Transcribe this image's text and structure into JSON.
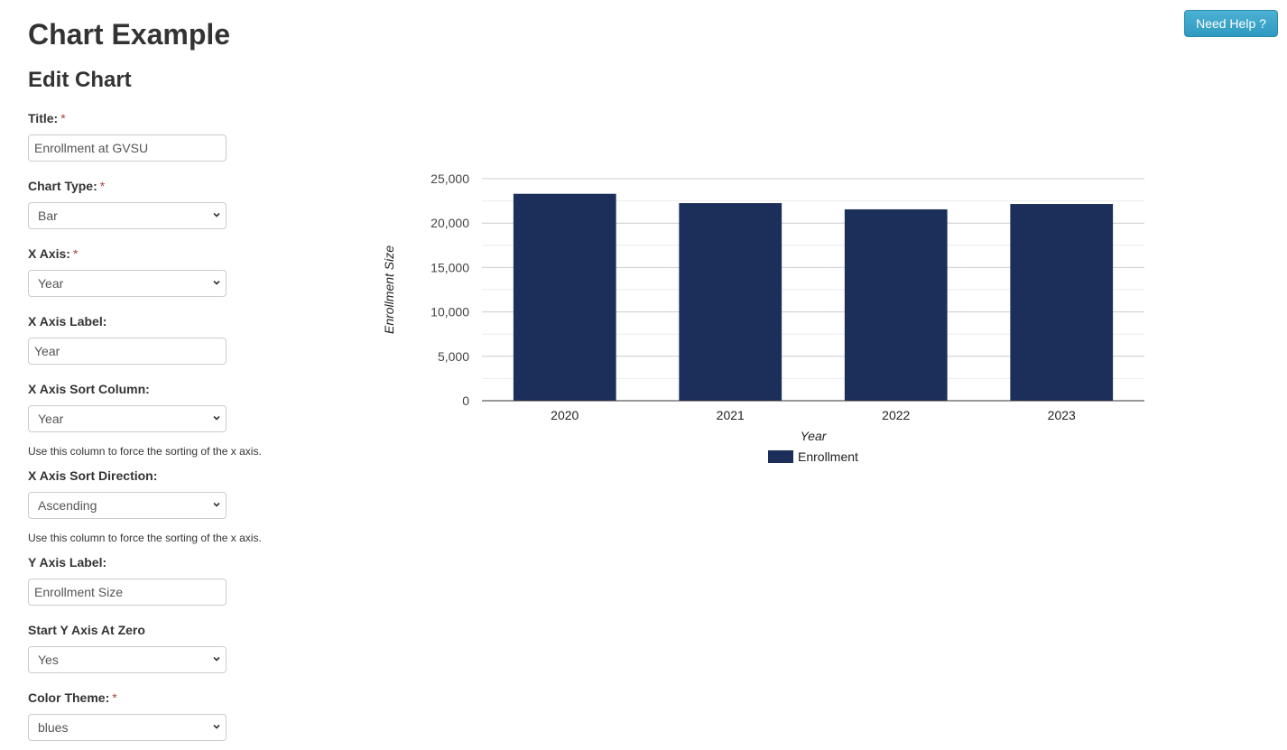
{
  "header": {
    "title": "Chart Example",
    "subtitle": "Edit Chart",
    "help_button": "Need Help ?"
  },
  "form": {
    "title": {
      "label": "Title:",
      "required": "*",
      "value": "Enrollment at GVSU"
    },
    "chart_type": {
      "label": "Chart Type:",
      "required": "*",
      "value": "Bar"
    },
    "x_axis": {
      "label": "X Axis:",
      "required": "*",
      "value": "Year"
    },
    "x_axis_label": {
      "label": "X Axis Label:",
      "value": "Year"
    },
    "x_sort_column": {
      "label": "X Axis Sort Column:",
      "value": "Year",
      "help": "Use this column to force the sorting of the x axis."
    },
    "x_sort_direction": {
      "label": "X Axis Sort Direction:",
      "value": "Ascending",
      "help": "Use this column to force the sorting of the x axis."
    },
    "y_axis_label": {
      "label": "Y Axis Label:",
      "value": "Enrollment Size"
    },
    "y_start_zero": {
      "label": "Start Y Axis At Zero",
      "value": "Yes"
    },
    "color_theme": {
      "label": "Color Theme:",
      "required": "*",
      "value": "blues"
    }
  },
  "colors": {
    "bar": "#1c2f5b",
    "help_button": "#39a5cb",
    "required": "#a94442"
  },
  "chart_data": {
    "type": "bar",
    "title": "",
    "categories": [
      "2020",
      "2021",
      "2022",
      "2023"
    ],
    "series": [
      {
        "name": "Enrollment",
        "values": [
          23300,
          22250,
          21550,
          22150
        ]
      }
    ],
    "xlabel": "Year",
    "ylabel": "Enrollment Size",
    "ylim": [
      0,
      25000
    ],
    "yticks": [
      0,
      5000,
      10000,
      15000,
      20000,
      25000
    ],
    "ytick_labels": [
      "0",
      "5,000",
      "10,000",
      "15,000",
      "20,000",
      "25,000"
    ],
    "grid": true,
    "legend": "bottom"
  }
}
